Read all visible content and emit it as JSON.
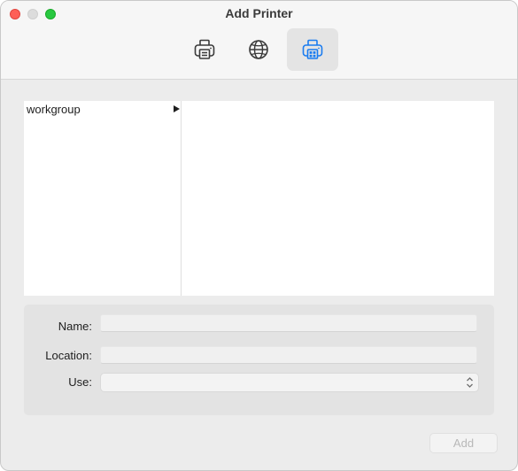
{
  "window": {
    "title": "Add Printer"
  },
  "toolbar": {
    "items": [
      {
        "icon": "default-printer-icon",
        "selected": false
      },
      {
        "icon": "ip-globe-icon",
        "selected": false
      },
      {
        "icon": "windows-printer-icon",
        "selected": true
      }
    ],
    "accent_color": "#1a7cf0"
  },
  "browser": {
    "column1": [
      {
        "label": "workgroup",
        "has_children": true
      }
    ]
  },
  "form": {
    "name_label": "Name:",
    "name_value": "",
    "location_label": "Location:",
    "location_value": "",
    "use_label": "Use:",
    "use_value": ""
  },
  "actions": {
    "add_label": "Add",
    "add_enabled": false
  }
}
